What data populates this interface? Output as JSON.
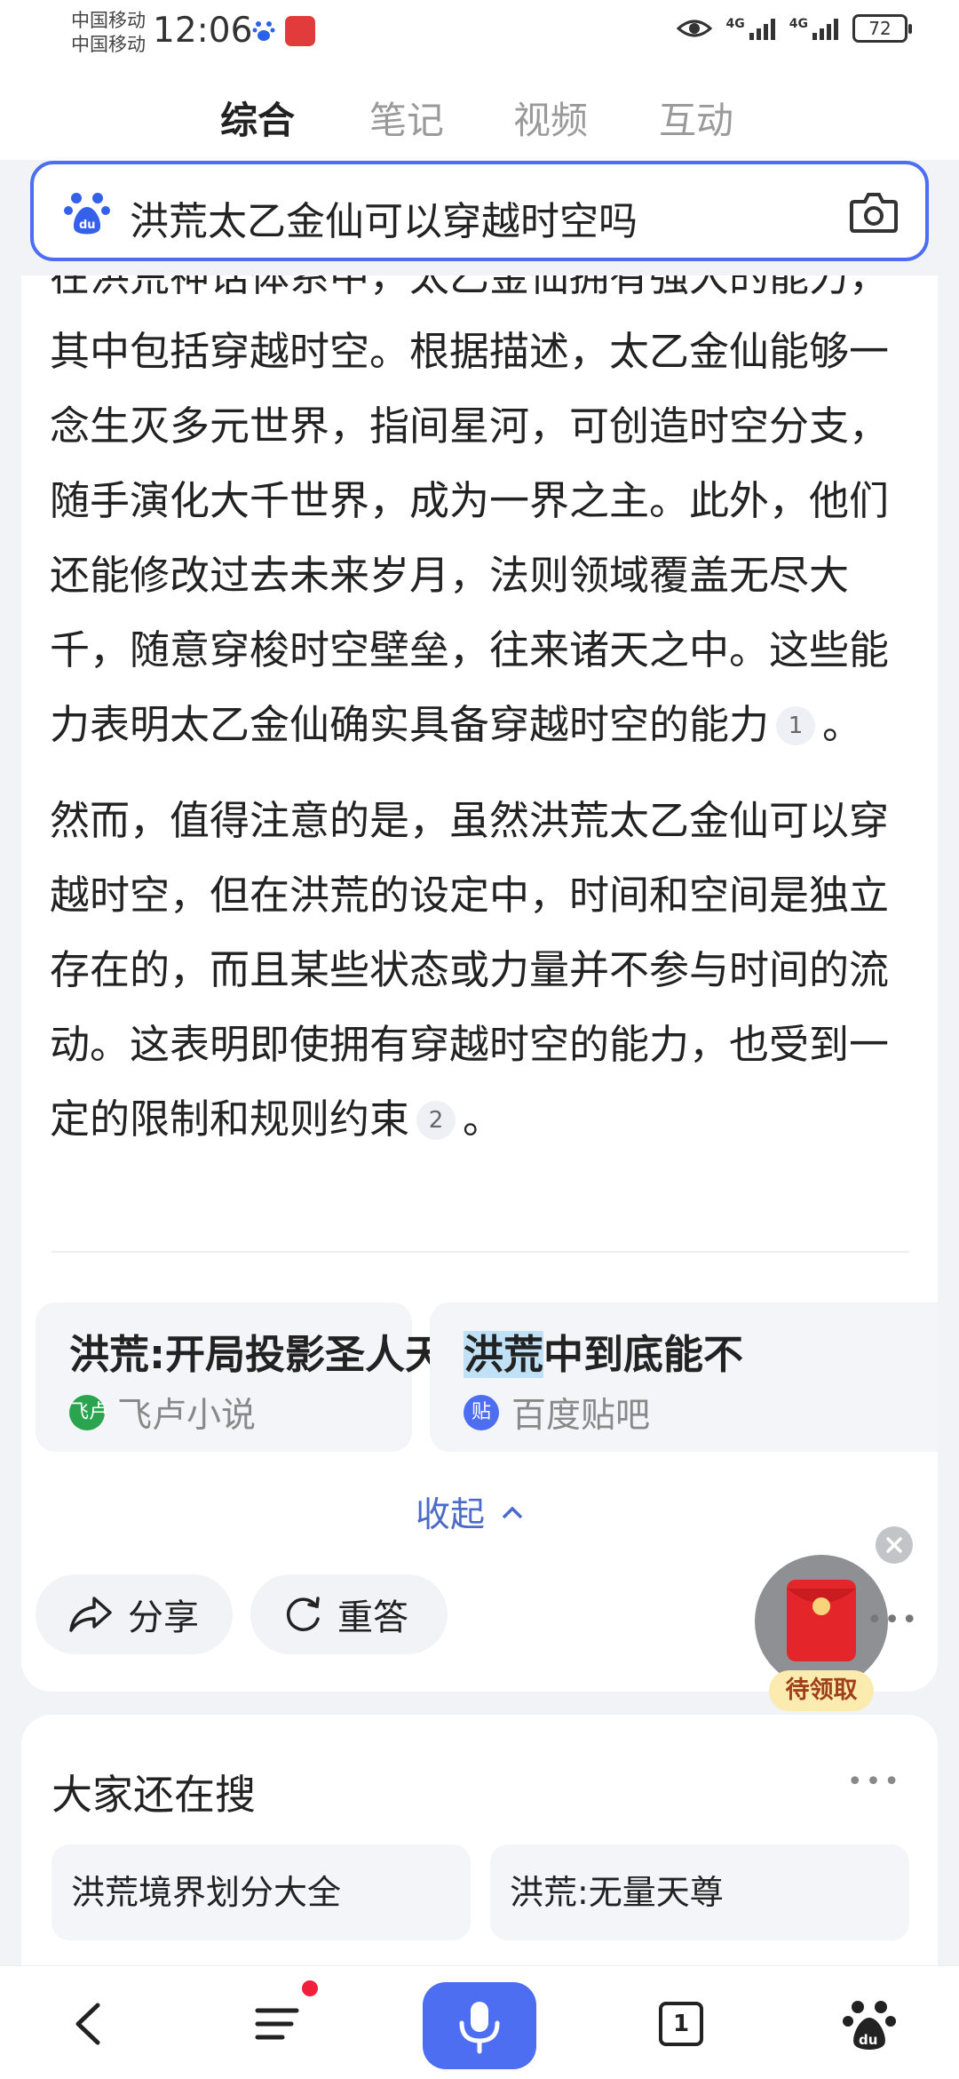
{
  "status_bar": {
    "carrier1": "中国移动",
    "carrier2": "中国移动",
    "time": "12:06",
    "net1": "4G",
    "net2": "4G",
    "battery": "72"
  },
  "tabs": [
    {
      "label": "综合",
      "active": true
    },
    {
      "label": "笔记",
      "active": false
    },
    {
      "label": "视频",
      "active": false
    },
    {
      "label": "互动",
      "active": false
    }
  ],
  "search": {
    "query": "洪荒太乙金仙可以穿越时空吗"
  },
  "answer": {
    "p1_text": "在洪荒神话体系中，太乙金仙拥有强大的能力，其中包括穿越时空。根据描述，太乙金仙能够一念生灭多元世界，指间星河，可创造时空分支，随手演化大千世界，成为一界之主。此外，他们还能修改过去未来岁月，法则领域覆盖无尽大千，随意穿梭时空壁垒，往来诸天之中。这些能力表明太乙金仙确实具备穿越时空的能力",
    "p1_cite": "1",
    "p1_end": "。",
    "p2_text": "然而，值得注意的是，虽然洪荒太乙金仙可以穿越时空，但在洪荒的设定中，时间和空间是独立存在的，而且某些状态或力量并不参与时间的流动。这表明即使拥有穿越时空的能力，也受到一定的限制和规则约束",
    "p2_cite": "2",
    "p2_end": "。"
  },
  "sources": [
    {
      "title": "洪荒:开局投影圣人天赋",
      "site": "飞卢小说",
      "icon_text": "飞卢"
    },
    {
      "title_highlight": "洪荒",
      "title_rest": "中到底能不",
      "site": "百度贴吧",
      "icon_text": "贴"
    }
  ],
  "collapse_label": "收起",
  "actions": {
    "share": "分享",
    "regenerate": "重答"
  },
  "red_packet": {
    "label": "待领取"
  },
  "also_search": {
    "title": "大家还在搜",
    "items": [
      "洪荒境界划分大全",
      "洪荒:无量天尊"
    ]
  },
  "bottom_bar": {
    "tab_count": "1"
  },
  "colors": {
    "brand_blue": "#4e6ef2",
    "link_blue": "#4b6bc9",
    "red": "#e4262b"
  }
}
